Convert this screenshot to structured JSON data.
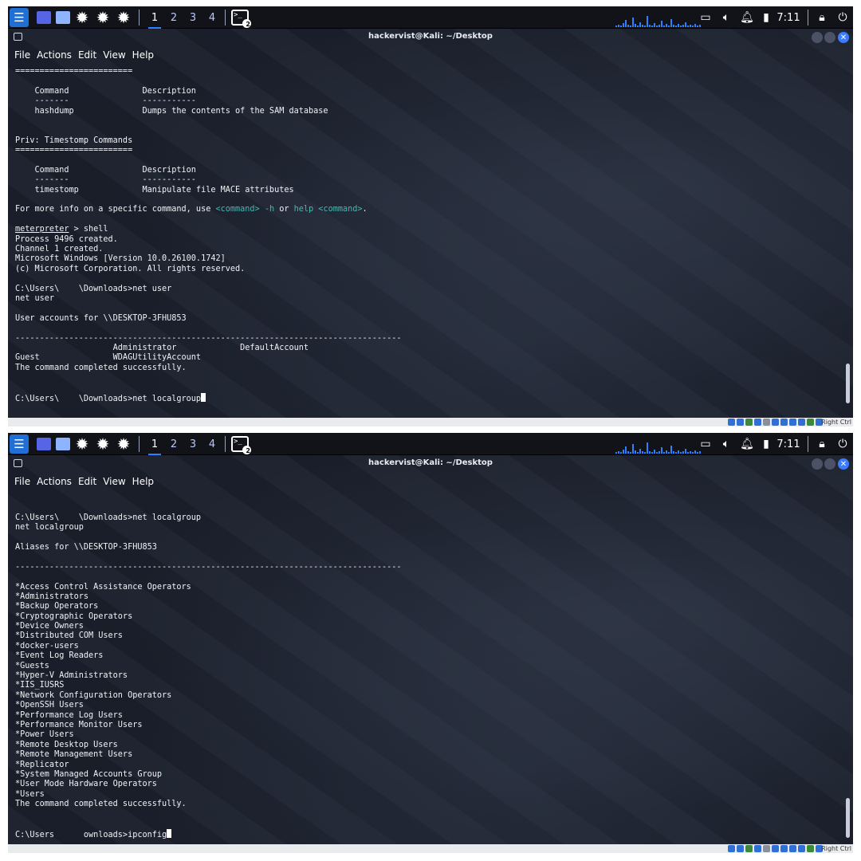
{
  "panel": {
    "workspaces": [
      "1",
      "2",
      "3",
      "4"
    ],
    "terminal_badge": "2",
    "clock": "7:11",
    "icons": [
      "kali-menu-icon",
      "show-desktop-icon",
      "file-manager-icon",
      "gear-icon",
      "gear-icon",
      "gear-icon",
      "terminal-icon",
      "display-icon",
      "volume-icon",
      "bell-icon",
      "battery-icon",
      "lock-icon",
      "logout-icon"
    ]
  },
  "window": {
    "title": "hackervist@Kali: ~/Desktop",
    "menu": [
      "File",
      "Actions",
      "Edit",
      "View",
      "Help"
    ]
  },
  "top_terminal": [
    "========================",
    "",
    "    Command               Description",
    "    -------               -----------",
    "    hashdump              Dumps the contents of the SAM database",
    "",
    "",
    "Priv: Timestomp Commands",
    "========================",
    "",
    "    Command               Description",
    "    -------               -----------",
    "    timestomp             Manipulate file MACE attributes",
    "",
    "For more info on a specific command, use <command> -h or help <command>.",
    "",
    "meterpreter > shell",
    "Process 9496 created.",
    "Channel 1 created.",
    "Microsoft Windows [Version 10.0.26100.1742]",
    "(c) Microsoft Corporation. All rights reserved.",
    "",
    "C:\\Users\\    \\Downloads>net user",
    "net user",
    "",
    "User accounts for \\\\DESKTOP-3FHU853",
    "",
    "-------------------------------------------------------------------------------",
    "                    Administrator             DefaultAccount",
    "Guest               WDAGUtilityAccount",
    "The command completed successfully.",
    "",
    "",
    "C:\\Users\\    \\Downloads>net localgroup"
  ],
  "bottom_terminal": [
    "",
    "",
    "C:\\Users\\    \\Downloads>net localgroup",
    "net localgroup",
    "",
    "Aliases for \\\\DESKTOP-3FHU853",
    "",
    "-------------------------------------------------------------------------------",
    "",
    "*Access Control Assistance Operators",
    "*Administrators",
    "*Backup Operators",
    "*Cryptographic Operators",
    "*Device Owners",
    "*Distributed COM Users",
    "*docker-users",
    "*Event Log Readers",
    "*Guests",
    "*Hyper-V Administrators",
    "*IIS_IUSRS",
    "*Network Configuration Operators",
    "*OpenSSH Users",
    "*Performance Log Users",
    "*Performance Monitor Users",
    "*Power Users",
    "*Remote Desktop Users",
    "*Remote Management Users",
    "*Replicator",
    "*System Managed Accounts Group",
    "*User Mode Hardware Operators",
    "*Users",
    "The command completed successfully.",
    "",
    "",
    "C:\\Users      ownloads>ipconfig"
  ],
  "vbox_status": {
    "host_key": "Right Ctrl",
    "icon_colors": [
      "#2f6fd6",
      "#2f6fd6",
      "#3a8a3a",
      "#2f6fd6",
      "#8a8f9a",
      "#2f6fd6",
      "#2f6fd6",
      "#2f6fd6",
      "#2f6fd6",
      "#3a8a3a",
      "#2f6fd6"
    ]
  },
  "colors": {
    "accent": "#2f80ff",
    "terminal_bg": "#1a1f2b",
    "highlight": "#48b8b0"
  }
}
